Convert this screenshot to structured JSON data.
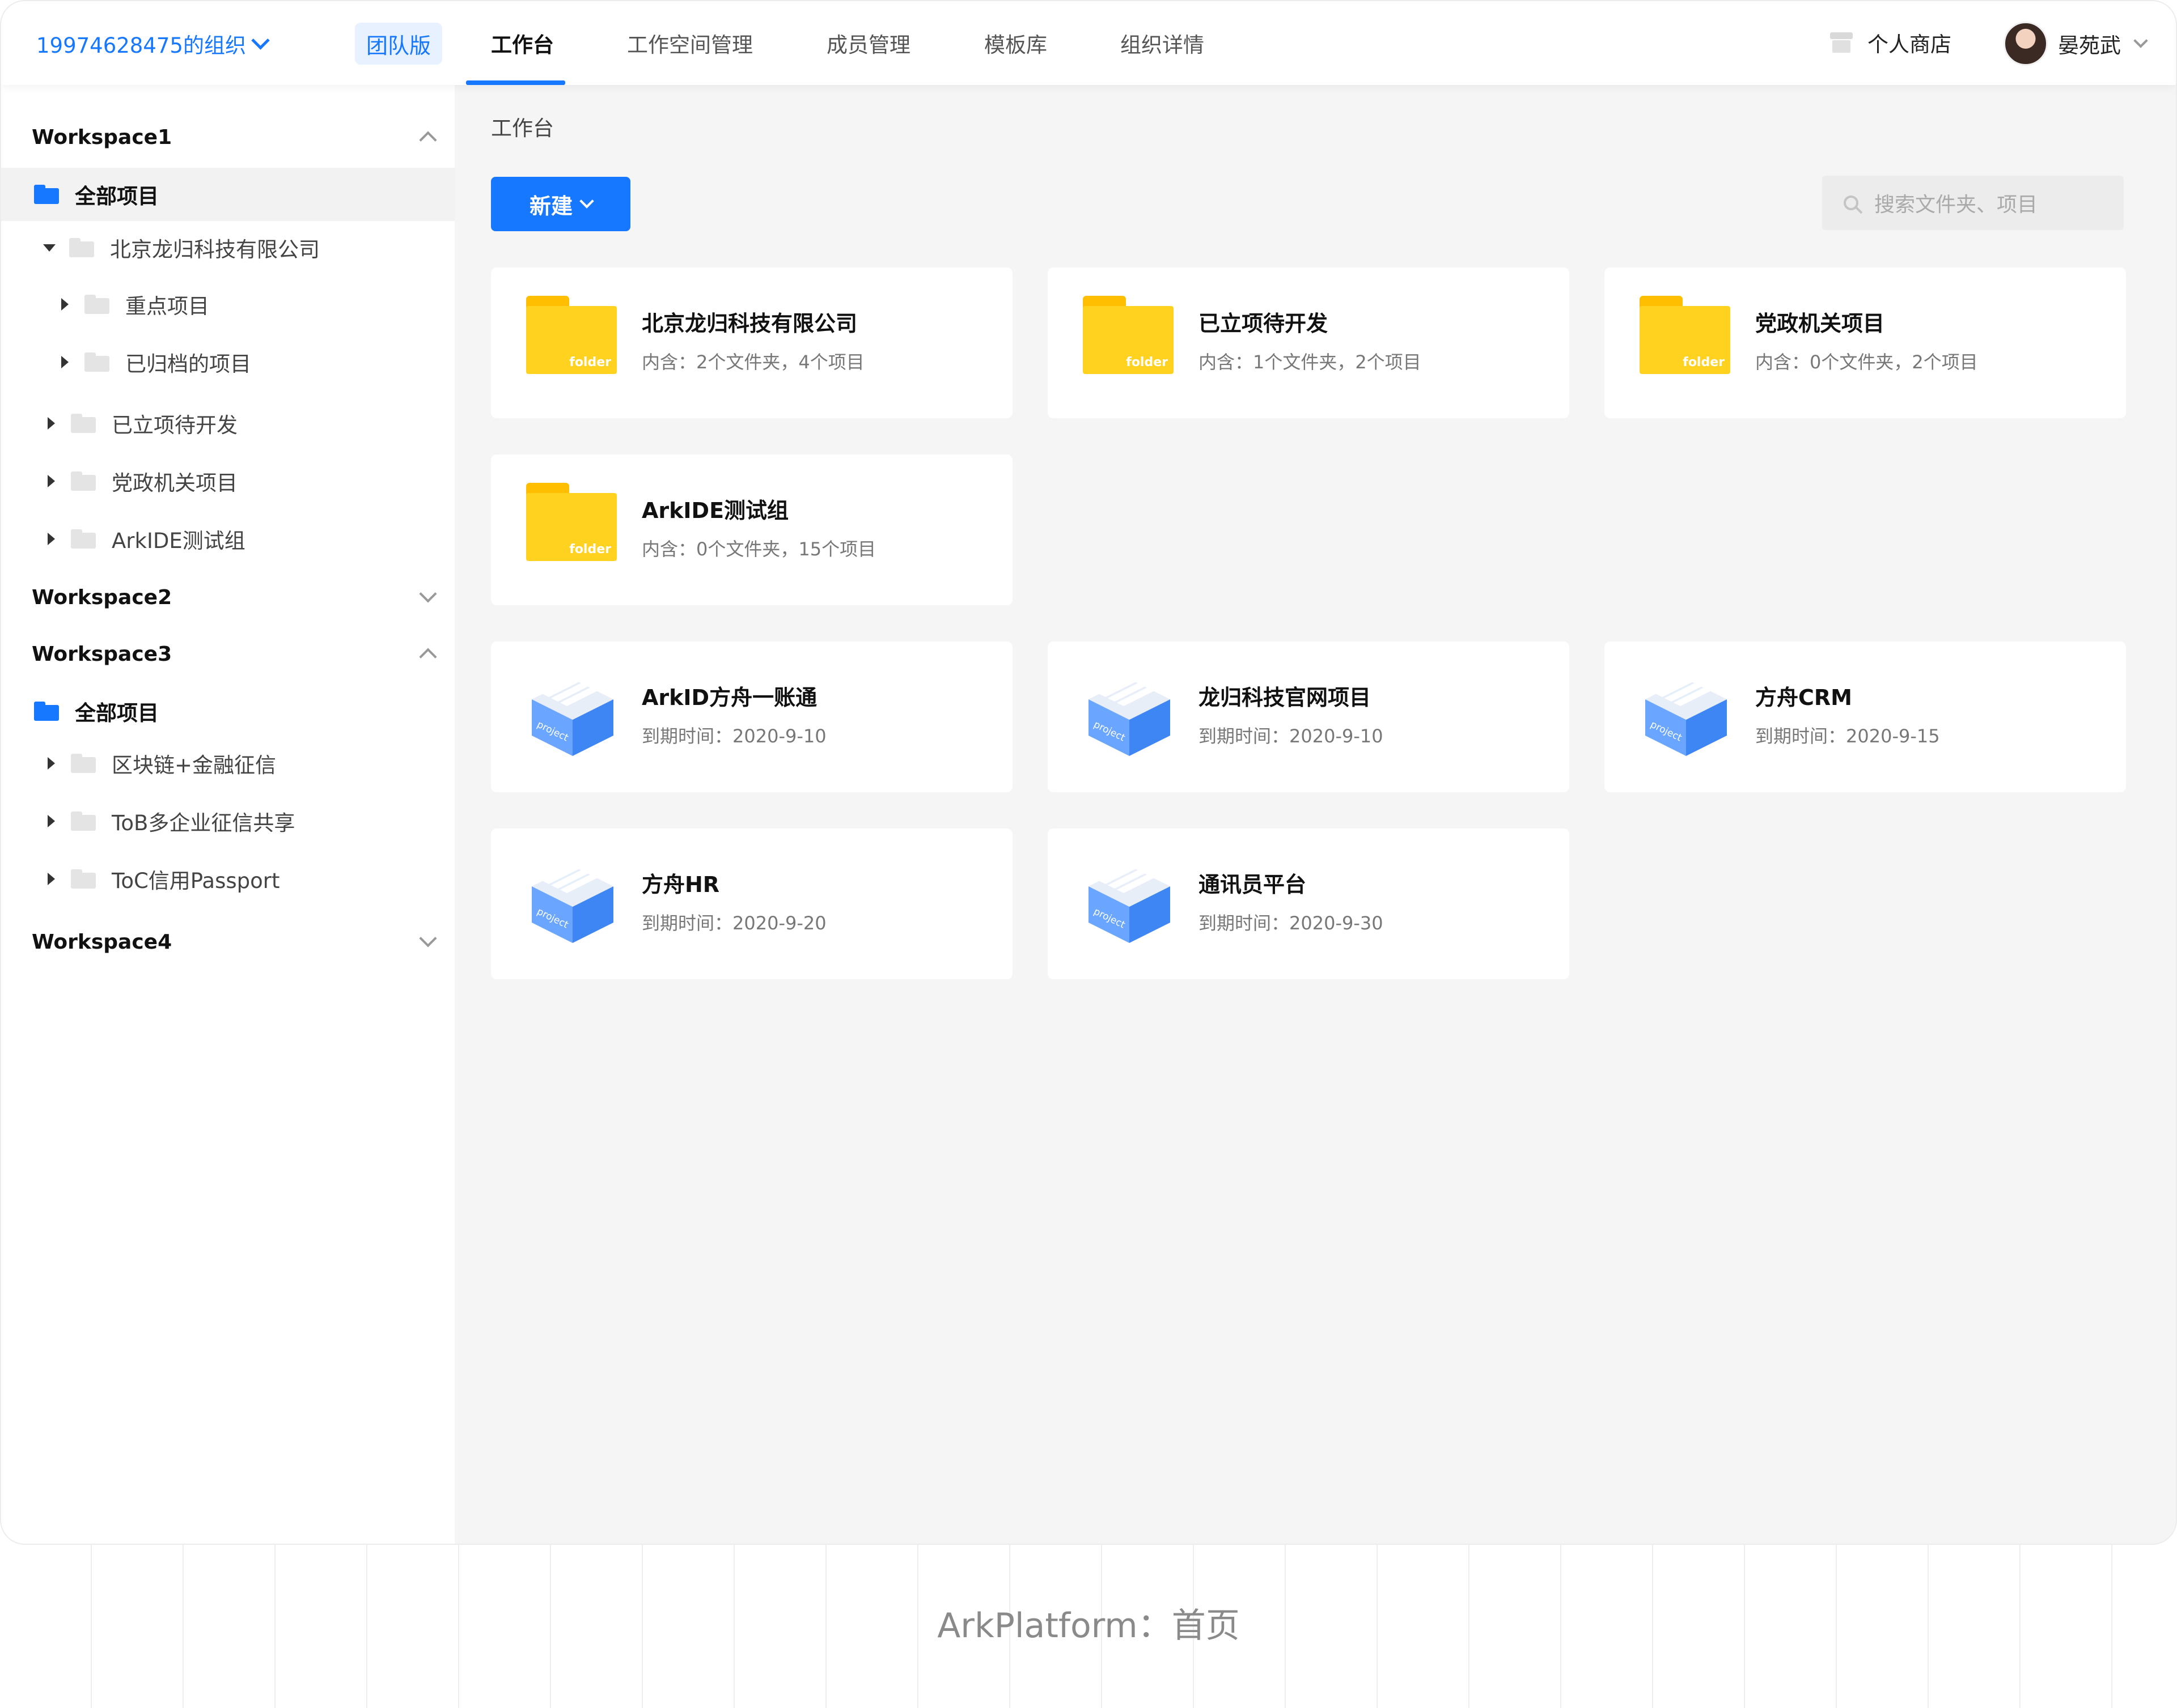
{
  "topbar": {
    "org_name": "19974628475的组织",
    "edition": "团队版",
    "nav": [
      "工作台",
      "工作空间管理",
      "成员管理",
      "模板库",
      "组织详情"
    ],
    "active_nav": "工作台",
    "store": "个人商店",
    "user_name": "晏苑武"
  },
  "sidebar": {
    "ws1": {
      "name": "Workspace1",
      "all": "全部项目",
      "items": [
        "北京龙归科技有限公司",
        "重点项目",
        "已归档的项目",
        "已立项待开发",
        "党政机关项目",
        "ArkIDE测试组"
      ]
    },
    "ws2": {
      "name": "Workspace2"
    },
    "ws3": {
      "name": "Workspace3",
      "all": "全部项目",
      "items": [
        "区块链+金融征信",
        "ToB多企业征信共享",
        "ToC信用Passport"
      ]
    },
    "ws4": {
      "name": "Workspace4"
    }
  },
  "main": {
    "breadcrumb": "工作台",
    "new_button": "新建",
    "search_placeholder": "搜索文件夹、项目",
    "folder_label": "folder",
    "project_label": "project",
    "folders": [
      {
        "title": "北京龙归科技有限公司",
        "sub": "内含：2个文件夹，4个项目"
      },
      {
        "title": "已立项待开发",
        "sub": "内含：1个文件夹，2个项目"
      },
      {
        "title": "党政机关项目",
        "sub": "内含：0个文件夹，2个项目"
      },
      {
        "title": "ArkIDE测试组",
        "sub": "内含：0个文件夹，15个项目"
      }
    ],
    "projects": [
      {
        "title": "ArkID方舟一账通",
        "sub": "到期时间：2020-9-10"
      },
      {
        "title": "龙归科技官网项目",
        "sub": "到期时间：2020-9-10"
      },
      {
        "title": "方舟CRM",
        "sub": "到期时间：2020-9-15"
      },
      {
        "title": "方舟HR",
        "sub": "到期时间：2020-9-20"
      },
      {
        "title": "通讯员平台",
        "sub": "到期时间：2020-9-30"
      }
    ]
  },
  "caption": "ArkPlatform：首页",
  "colors": {
    "accent": "#1677ff",
    "folder": "#ffd21f",
    "project": "#5b9af5"
  }
}
